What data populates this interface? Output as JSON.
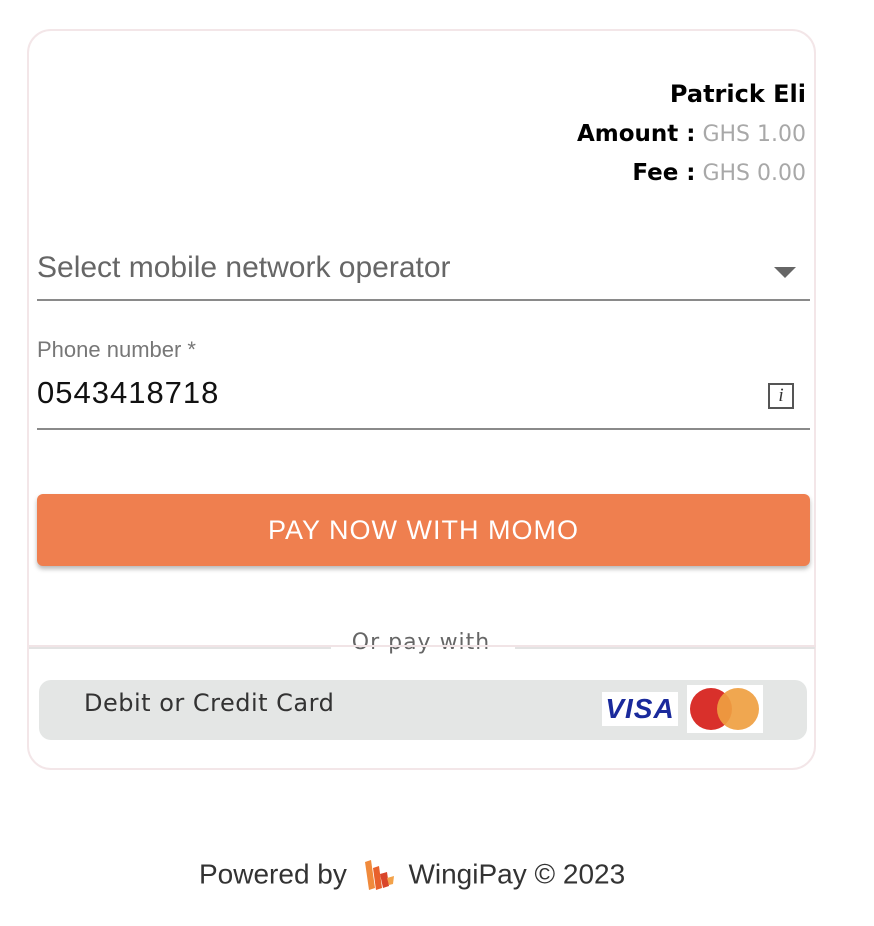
{
  "summary": {
    "payer_name": "Patrick Eli",
    "amount_label": "Amount :",
    "amount_value": "GHS 1.00",
    "fee_label": "Fee :",
    "fee_value": "GHS 0.00"
  },
  "network_select": {
    "placeholder": "Select mobile network operator"
  },
  "phone": {
    "label": "Phone number *",
    "value": "0543418718",
    "info_icon": "i"
  },
  "pay_button": {
    "label": "PAY NOW WITH MOMO"
  },
  "alternative": {
    "divider_text": "Or pay with",
    "card_option_label": "Debit or Credit Card",
    "visa_text": "VISA"
  },
  "footer": {
    "powered_by": "Powered by",
    "brand": "WingiPay © 2023"
  },
  "colors": {
    "accent": "#ef7f4f",
    "mastercard_red": "#d9302b",
    "mastercard_orange": "#efa041",
    "visa_blue": "#1a2a9c"
  },
  "icons": [
    "chevron-down-icon",
    "info-icon",
    "visa-logo",
    "mastercard-logo",
    "wingipay-logo"
  ]
}
